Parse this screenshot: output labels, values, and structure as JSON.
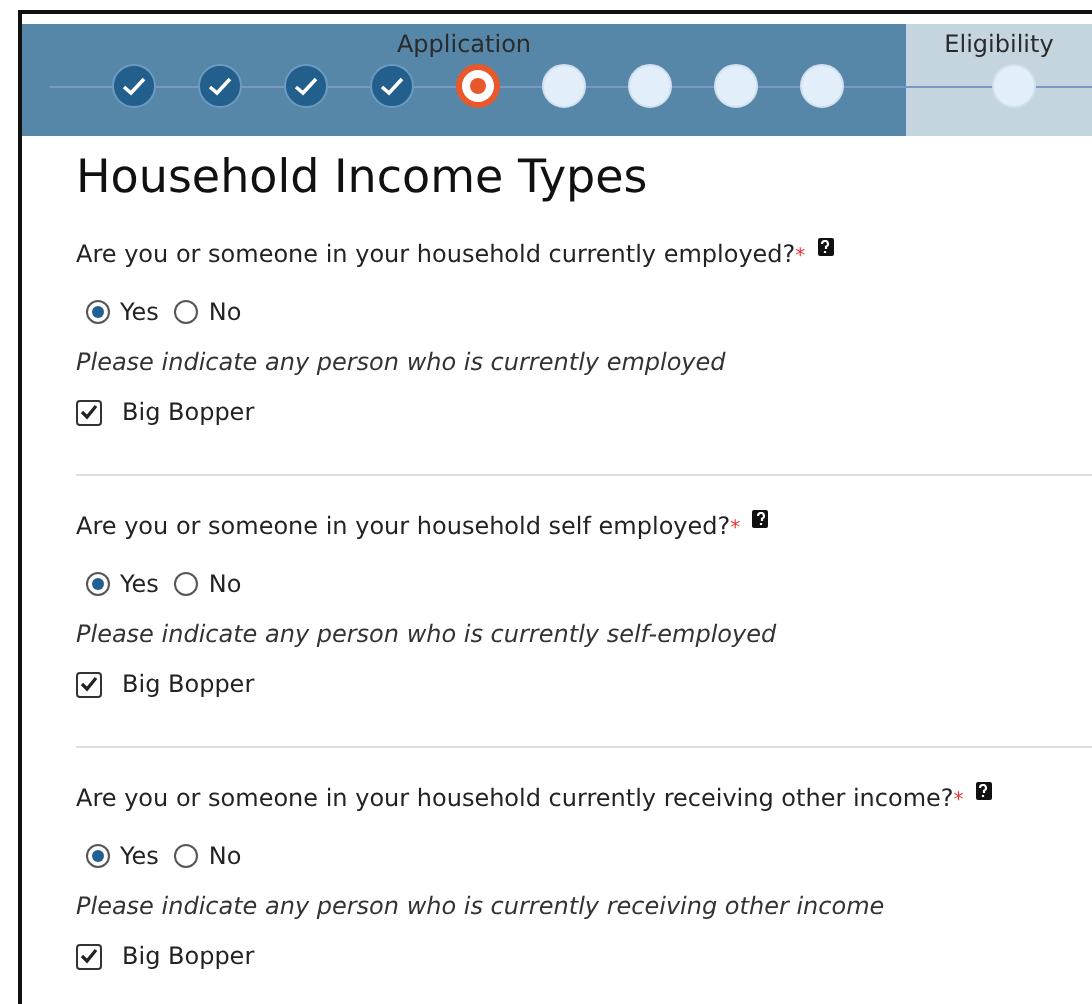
{
  "progress": [
    {
      "label": "Application",
      "selected": true,
      "steps": [
        {
          "done": true,
          "current": false
        },
        {
          "done": true,
          "current": false
        },
        {
          "done": true,
          "current": false
        },
        {
          "done": true,
          "current": false
        },
        {
          "done": false,
          "current": true
        },
        {
          "done": false,
          "current": false
        },
        {
          "done": false,
          "current": false
        },
        {
          "done": false,
          "current": false
        },
        {
          "done": false,
          "current": false
        }
      ]
    },
    {
      "label": "Eligibility",
      "selected": false,
      "steps": [
        {
          "done": false,
          "current": false
        }
      ]
    }
  ],
  "heading": "Household Income Types",
  "questions": [
    {
      "text": "Are you or someone in your household currently employed?",
      "required_mark": "*",
      "options": [
        {
          "label": "Yes",
          "selected": true
        },
        {
          "label": "No",
          "selected": false
        }
      ],
      "hint": "Please indicate any person who is currently employed",
      "people": [
        {
          "name": "Big Bopper",
          "checked": true
        }
      ]
    },
    {
      "text": "Are you or someone in your household self employed?",
      "required_mark": "*",
      "options": [
        {
          "label": "Yes",
          "selected": true
        },
        {
          "label": "No",
          "selected": false
        }
      ],
      "hint": "Please indicate any person who is currently self-employed",
      "people": [
        {
          "name": "Big Bopper",
          "checked": true
        }
      ]
    },
    {
      "text": "Are you or someone in your household currently receiving other income?",
      "required_mark": "*",
      "options": [
        {
          "label": "Yes",
          "selected": true
        },
        {
          "label": "No",
          "selected": false
        }
      ],
      "hint": "Please indicate any person who is currently receiving other income",
      "people": [
        {
          "name": "Big Bopper",
          "checked": true
        }
      ]
    }
  ]
}
